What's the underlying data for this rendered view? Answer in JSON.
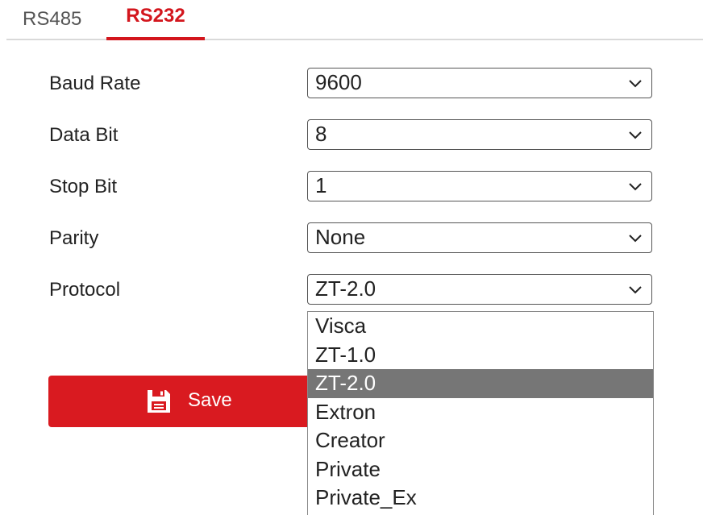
{
  "tabs": [
    {
      "label": "RS485",
      "active": false
    },
    {
      "label": "RS232",
      "active": true
    }
  ],
  "form": {
    "baud_rate": {
      "label": "Baud Rate",
      "value": "9600"
    },
    "data_bit": {
      "label": "Data Bit",
      "value": "8"
    },
    "stop_bit": {
      "label": "Stop Bit",
      "value": "1"
    },
    "parity": {
      "label": "Parity",
      "value": "None"
    },
    "protocol": {
      "label": "Protocol",
      "value": "ZT-2.0"
    }
  },
  "save_button": {
    "label": "Save",
    "icon": "save-icon"
  },
  "protocol_dropdown": {
    "open": true,
    "selected": "ZT-2.0",
    "options": [
      "Visca",
      "ZT-1.0",
      "ZT-2.0",
      "Extron",
      "Creator",
      "Private",
      "Private_Ex"
    ]
  },
  "colors": {
    "accent": "#d3161d",
    "button": "#d91a20",
    "option_highlight": "#767676"
  }
}
